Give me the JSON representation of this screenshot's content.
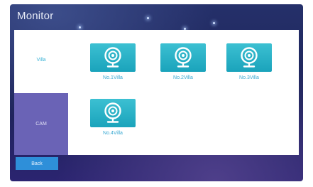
{
  "header": {
    "title": "Monitor"
  },
  "sidebar": {
    "tabs": [
      {
        "label": "Villa"
      },
      {
        "label": "CAM"
      }
    ]
  },
  "cameras": [
    {
      "label": "No.1Villa",
      "icon": "webcam-icon"
    },
    {
      "label": "No.2Villa",
      "icon": "webcam-icon"
    },
    {
      "label": "No.3Villa",
      "icon": "webcam-icon"
    },
    {
      "label": "No.4Villa",
      "icon": "webcam-icon"
    }
  ],
  "footer": {
    "back_label": "Back"
  },
  "colors": {
    "background": "#1d2459",
    "active_tab": "#6a63b6",
    "camera_tile": "#1aa3bb",
    "accent_text": "#39a9d2",
    "back_button": "#2e8fd9"
  }
}
